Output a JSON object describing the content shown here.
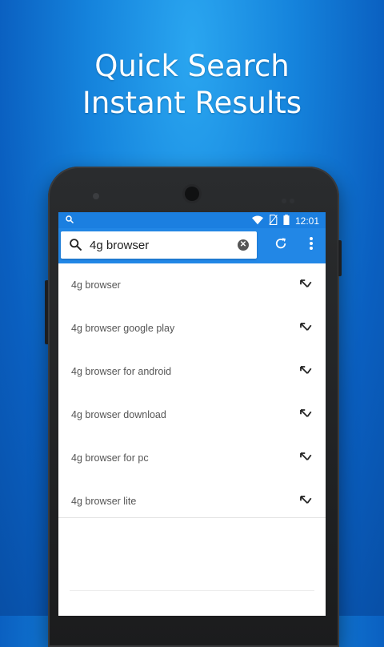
{
  "headline": {
    "line1": "Quick Search",
    "line2": "Instant Results"
  },
  "status_bar": {
    "time": "12:01",
    "icons": [
      "search-icon",
      "wifi-icon",
      "no-sim-icon",
      "battery-icon"
    ]
  },
  "search": {
    "value": "4g browser",
    "clear_icon": "close-circle-icon",
    "search_icon": "search-icon"
  },
  "toolbar": {
    "refresh_icon": "refresh-icon",
    "menu_icon": "more-vertical-icon"
  },
  "results": [
    {
      "text": "4g browser"
    },
    {
      "text": "4g browser google play"
    },
    {
      "text": "4g browser for android"
    },
    {
      "text": "4g browser download"
    },
    {
      "text": "4g browser for pc"
    },
    {
      "text": "4g browser lite"
    }
  ],
  "colors": {
    "accent": "#2287e6",
    "status_bar": "#1b7fe0",
    "background": "#1583dc"
  }
}
